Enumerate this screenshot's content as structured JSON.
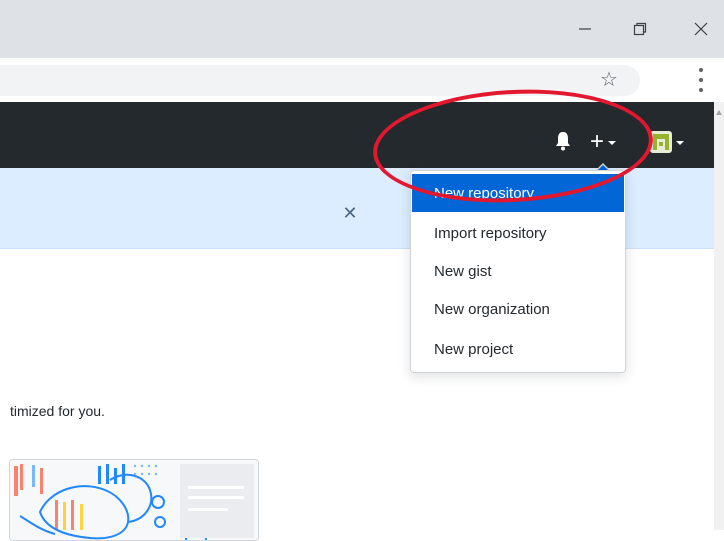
{
  "window": {
    "minimize_icon": "minimize-icon",
    "restore_icon": "restore-icon",
    "close_icon": "close-icon"
  },
  "browser": {
    "url": "",
    "bookmark_icon": "star-icon",
    "menu_icon": "kebab-menu-icon"
  },
  "header": {
    "notifications_icon": "bell-icon",
    "create_icon": "plus-icon",
    "avatar_icon": "avatar-icon",
    "brand_color": "#24292e"
  },
  "flash": {
    "close_icon": "close-icon",
    "background": "#dbedff"
  },
  "dropdown": {
    "items": [
      {
        "label": "New repository",
        "active": true
      },
      {
        "label": "Import repository",
        "active": false
      },
      {
        "label": "New gist",
        "active": false
      },
      {
        "label": "New organization",
        "active": false
      },
      {
        "label": "New project",
        "active": false
      }
    ],
    "highlight_color": "#0366d6"
  },
  "main": {
    "intro_text": "timized for you."
  },
  "annotation": {
    "color": "#e3172d"
  }
}
